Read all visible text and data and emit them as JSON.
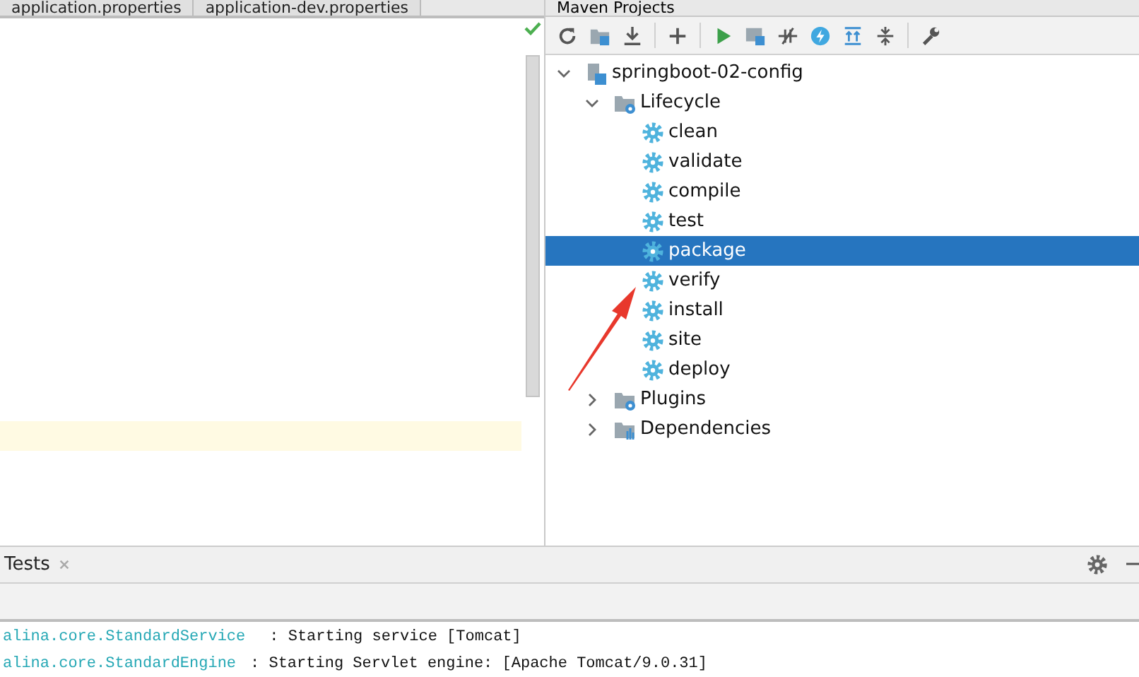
{
  "editor_tabs": [
    {
      "label": "application.properties",
      "selected": false
    },
    {
      "label": "application-dev.properties",
      "selected": false
    }
  ],
  "maven_panel": {
    "title": "Maven Projects",
    "tree": [
      {
        "label": "springboot-02-config",
        "kind": "project",
        "expanded": true,
        "selected": false,
        "children": [
          {
            "label": "Lifecycle",
            "kind": "lifecycle",
            "expanded": true,
            "selected": false,
            "children": [
              {
                "label": "clean",
                "kind": "goal",
                "selected": false
              },
              {
                "label": "validate",
                "kind": "goal",
                "selected": false
              },
              {
                "label": "compile",
                "kind": "goal",
                "selected": false
              },
              {
                "label": "test",
                "kind": "goal",
                "selected": false
              },
              {
                "label": "package",
                "kind": "goal",
                "selected": true
              },
              {
                "label": "verify",
                "kind": "goal",
                "selected": false
              },
              {
                "label": "install",
                "kind": "goal",
                "selected": false
              },
              {
                "label": "site",
                "kind": "goal",
                "selected": false
              },
              {
                "label": "deploy",
                "kind": "goal",
                "selected": false
              }
            ]
          },
          {
            "label": "Plugins",
            "kind": "plugins",
            "expanded": false,
            "selected": false
          },
          {
            "label": "Dependencies",
            "kind": "dependencies",
            "expanded": false,
            "selected": false
          }
        ]
      }
    ]
  },
  "run_panel": {
    "tab": "Tests",
    "console": [
      {
        "logger": "alina.core.StandardService",
        "message": ": Starting service [Tomcat]"
      },
      {
        "logger": "alina.core.StandardEngine",
        "message": ": Starting Servlet engine: [Apache Tomcat/9.0.31]"
      }
    ]
  }
}
